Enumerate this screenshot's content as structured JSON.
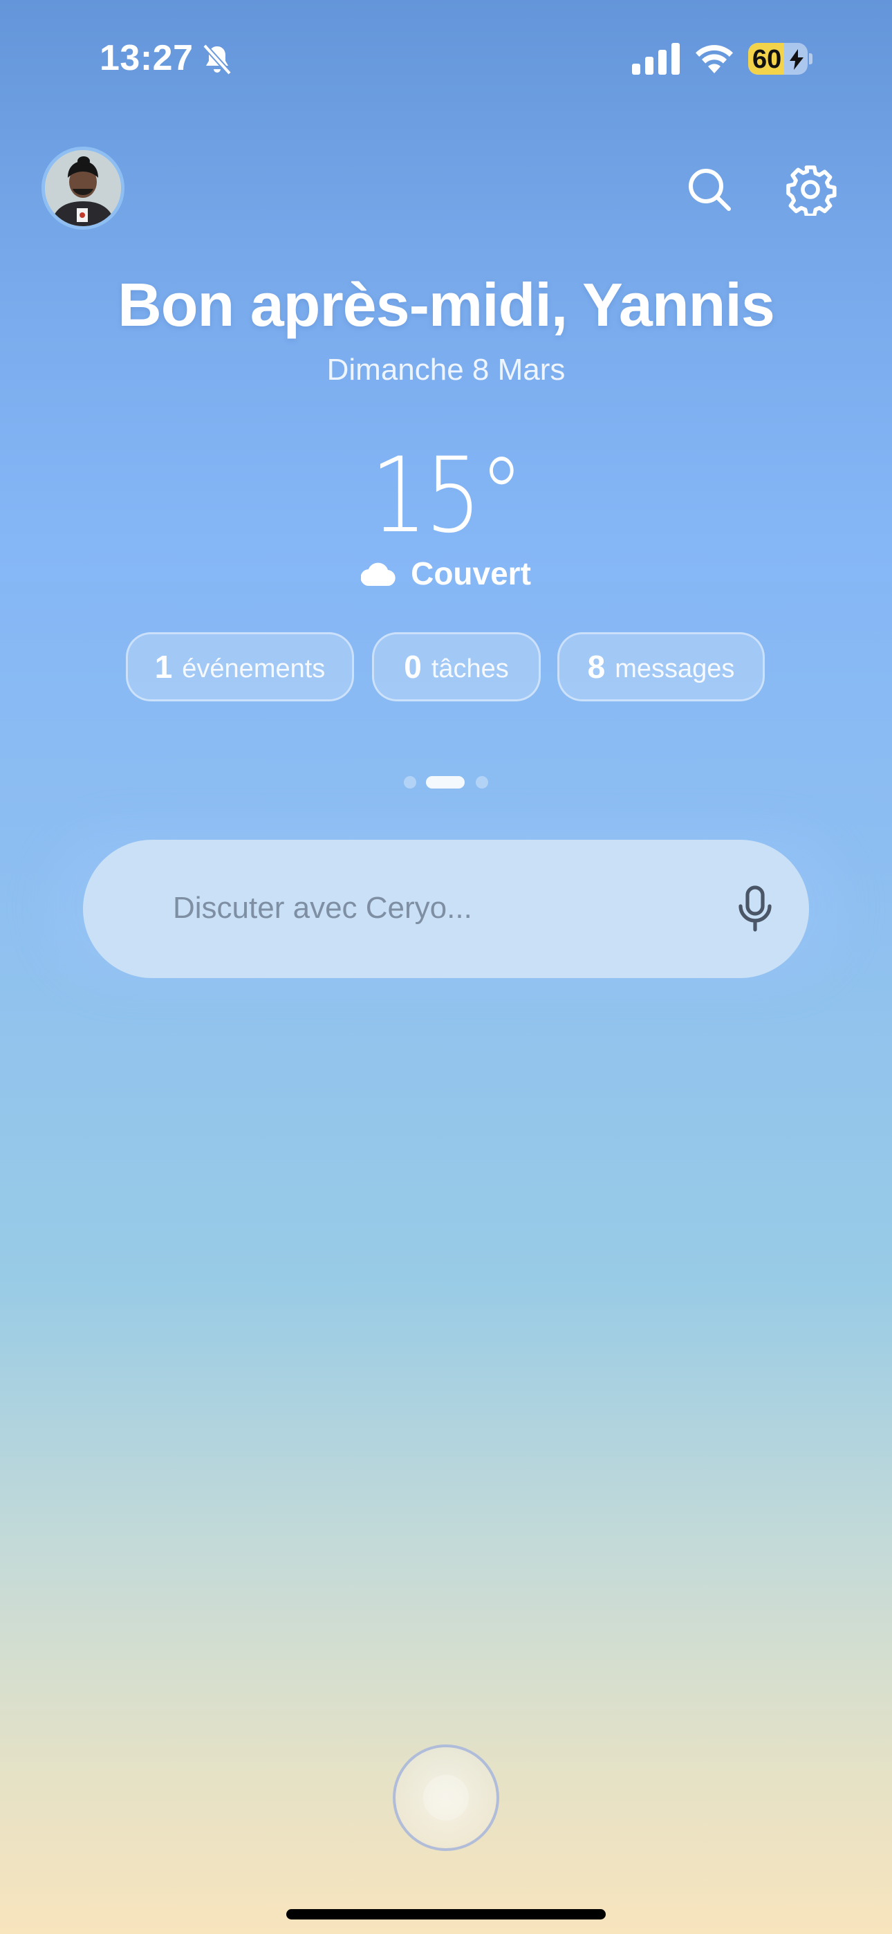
{
  "status_bar": {
    "time": "13:27",
    "battery_level": "60",
    "icons": [
      "bell-slash-icon",
      "signal-icon",
      "wifi-icon",
      "battery-charging-icon"
    ]
  },
  "header": {
    "avatar_icon": "user-avatar",
    "search_icon": "search-icon",
    "settings_icon": "gear-icon"
  },
  "greeting": "Bon après-midi, Yannis",
  "date": "Dimanche 8 Mars",
  "weather": {
    "temperature": "15°",
    "condition": "Couvert",
    "icon": "cloud-icon"
  },
  "summary_pills": [
    {
      "count": "1",
      "label": "événements"
    },
    {
      "count": "0",
      "label": "tâches"
    },
    {
      "count": "8",
      "label": "messages"
    }
  ],
  "page_indicator": {
    "total": 3,
    "active": 2
  },
  "chat": {
    "placeholder": "Discuter avec Ceryo...",
    "mic_icon": "microphone-icon"
  },
  "bottom": {
    "orb_icon": "assistant-orb-icon"
  },
  "colors": {
    "sky_top": "#6495da",
    "sky_mid": "#85b6f6",
    "sand_bottom": "#f8e4bd",
    "battery_fill": "#f2d34a",
    "chat_bg": "#c9e0f6"
  }
}
